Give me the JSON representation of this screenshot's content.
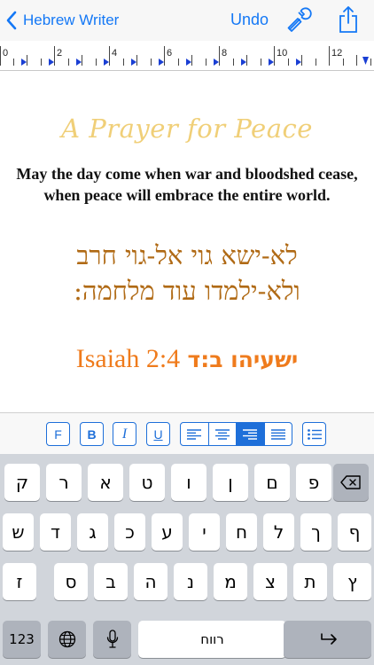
{
  "nav": {
    "back_label": "Hebrew Writer",
    "undo_label": "Undo",
    "settings_icon": "wrench-icon",
    "share_icon": "share-icon",
    "accent": "#1478f6"
  },
  "ruler": {
    "numbers": [
      "0",
      "2",
      "4",
      "6",
      "8",
      "10",
      "12"
    ]
  },
  "document": {
    "title": "A Prayer for Peace",
    "body": "May the day come when war and bloodshed cease, when peace will embrace the entire world.",
    "hebrew_line1": "לא-ישא גוי אל-גוי חרב",
    "hebrew_line2": "ולא-ילמדו עוד מלחמה:",
    "verse_english": "Isaiah 2:4",
    "verse_hebrew": "ישעיהו ב:ד",
    "colors": {
      "title": "#f0cf78",
      "hebrew": "#b06a15",
      "verse": "#ef7b1c"
    }
  },
  "format_toolbar": {
    "font_label": "F",
    "bold_label": "B",
    "italic_label": "I",
    "underline_label": "U",
    "alignments": [
      "align-left",
      "align-center",
      "align-right",
      "align-justify"
    ],
    "active_alignment": "align-right",
    "list_icon": "list-icon"
  },
  "keyboard": {
    "row1": [
      "ק",
      "ר",
      "א",
      "ט",
      "ו",
      "ן",
      "ם",
      "פ"
    ],
    "row2": [
      "ש",
      "ד",
      "ג",
      "כ",
      "ע",
      "י",
      "ח",
      "ל",
      "ך",
      "ף"
    ],
    "row3": [
      "ז",
      "ס",
      "ב",
      "ה",
      "נ",
      "מ",
      "צ",
      "ת",
      "ץ"
    ],
    "numbers_label": "123",
    "space_label": "רווח",
    "globe_icon": "globe-icon",
    "mic_icon": "microphone-icon",
    "delete_icon": "delete-icon",
    "return_icon": "return-icon"
  }
}
